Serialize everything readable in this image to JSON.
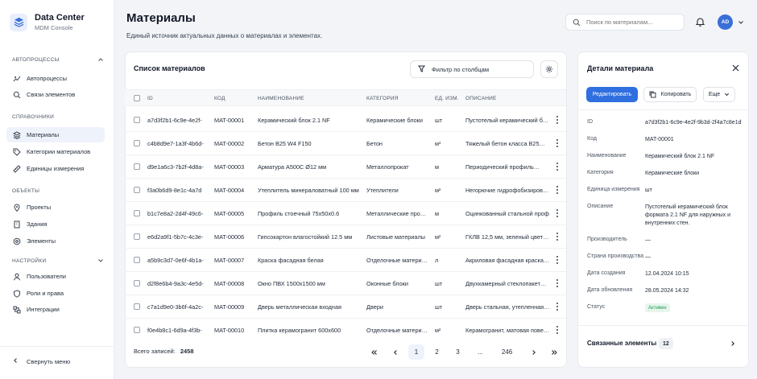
{
  "brand": {
    "title": "Data Center",
    "subtitle": "MDM Console"
  },
  "sidebar": {
    "sections": [
      {
        "label": "АВТОПРОЦЕССЫ"
      },
      {
        "label": "СПРАВОЧНИКИ"
      },
      {
        "label": "ОБЪЕКТЫ"
      },
      {
        "label": "НАСТРОЙКИ"
      }
    ],
    "items": [
      {
        "label": "Автопроцессы",
        "icon": "autoprocess-icon"
      },
      {
        "label": "Связи элементов",
        "icon": "link-search-icon"
      },
      {
        "label": "Материалы",
        "icon": "layers-icon",
        "active": true
      },
      {
        "label": "Категории материалов",
        "icon": "tag-icon"
      },
      {
        "label": "Единицы измерения",
        "icon": "ruler-icon"
      },
      {
        "label": "Проекты",
        "icon": "pin-icon"
      },
      {
        "label": "Здания",
        "icon": "building-icon"
      },
      {
        "label": "Элементы",
        "icon": "element-icon"
      },
      {
        "label": "Пользователи",
        "icon": "user-icon"
      },
      {
        "label": "Роли и права",
        "icon": "shield-icon"
      },
      {
        "label": "Интеграции",
        "icon": "integration-icon"
      }
    ],
    "collapse_label": "Свернуть меню"
  },
  "header": {
    "title": "Материалы",
    "subtitle": "Единый источник актуальных данных о материалах и элементах.",
    "search_placeholder": "Поиск по материалам...",
    "avatar": "AD"
  },
  "list": {
    "title": "Список материалов",
    "filter_label": "Фильтр по столбцам",
    "columns": [
      "ID",
      "КОД",
      "НАИМЕНОВАНИЕ",
      "КАТЕГОРИЯ",
      "ЕД. ИЗМ.",
      "ОПИСАНИЕ"
    ],
    "rows": [
      {
        "id": "a7d3f2b1-6c9e-4e2f-",
        "code": "MAT-00001",
        "name": "Керамический блок 2.1 NF",
        "category": "Керамические блоки",
        "unit": "шт",
        "desc": "Пустотелый керамический блок"
      },
      {
        "id": "c4b8d9e7-1a3f-4b6d-",
        "code": "MAT-00002",
        "name": "Бетон B25 W4 F150",
        "category": "Бетон",
        "unit": "м³",
        "desc": "Тяжелый бетон класса B25…"
      },
      {
        "id": "d9e1a6c3-7b2f-4d8a-",
        "code": "MAT-00003",
        "name": "Арматура A500C Ø12 мм",
        "category": "Металлопрокат",
        "unit": "м",
        "desc": "Периодический профиль…"
      },
      {
        "id": "f3a0b6d9-8e1c-4a7d",
        "code": "MAT-00004",
        "name": "Утеплитель минераловатный 100 мм",
        "category": "Утеплители",
        "unit": "м²",
        "desc": "Негорючие гидрофобизирова…"
      },
      {
        "id": "b1c7e8a2-2d4f-49c6-",
        "code": "MAT-00005",
        "name": "Профиль стоечный 75x50x0.6",
        "category": "Металлические профили",
        "unit": "м",
        "desc": "Оцинкованный стальной проф"
      },
      {
        "id": "e6d2a9f1-5b7c-4c3e-",
        "code": "MAT-00006",
        "name": "Гипсокартон влагостойкий 12.5 мм",
        "category": "Листовые материалы",
        "unit": "м²",
        "desc": "ГКЛВ 12,5 мм, зеленый цвет…"
      },
      {
        "id": "a5b9c3d7-0e6f-4b1a-",
        "code": "MAT-00007",
        "name": "Краска фасадная белая",
        "category": "Отделочные материалы",
        "unit": "л",
        "desc": "Акриловая фасадная краска…"
      },
      {
        "id": "d2f8e6b4-9a3c-4e5d-",
        "code": "MAT-00008",
        "name": "Окно ПВХ 1500x1500 мм",
        "category": "Оконные блоки",
        "unit": "шт",
        "desc": "Двухкамерный стеклопакет…"
      },
      {
        "id": "c7a1d9e0-3b6f-4a2c-",
        "code": "MAT-00009",
        "name": "Дверь металлическая входная",
        "category": "Двери",
        "unit": "шт",
        "desc": "Дверь стальная, утепленная…"
      },
      {
        "id": "f0e4b8c1-6d9a-4f3b-",
        "code": "MAT-00010",
        "name": "Плитка керамогранит 600x600",
        "category": "Отделочные материалы",
        "unit": "м²",
        "desc": "Керамогранит, матовая повер…"
      }
    ],
    "total_label": "Всего записей:",
    "total_value": "2458",
    "pagination": {
      "pages": [
        "1",
        "2",
        "3",
        "...",
        "246"
      ],
      "current": "1"
    }
  },
  "details": {
    "title": "Детали материала",
    "edit_label": "Редактировать",
    "copy_label": "Копировать",
    "more_label": "Еще",
    "fields": [
      {
        "label": "ID",
        "value": "a7d3f2b1-6c9e-4e2f-9b3d-2f4a7c8e1d9b"
      },
      {
        "label": "Код",
        "value": "MAT-00001"
      },
      {
        "label": "Наименование",
        "value": "Керамический блок 2.1 NF"
      },
      {
        "label": "Категория",
        "value": "Керамические блоки"
      },
      {
        "label": "Единица измерения",
        "value": "шт"
      },
      {
        "label": "Описание",
        "value": "Пустотелый керамический блок формата 2.1 NF для наружных и внутренних стен."
      },
      {
        "label": "Производитель",
        "value": "—"
      },
      {
        "label": "Страна производства",
        "value": "—"
      },
      {
        "label": "Дата создания",
        "value": "12.04.2024 10:15"
      },
      {
        "label": "Дата обновления",
        "value": "28.05.2024 14:32"
      },
      {
        "label": "Статус",
        "value": "Активен"
      }
    ],
    "related_label": "Связанные элементы",
    "related_count": "12"
  },
  "colors": {
    "accent": "#2f6fe0",
    "status_active": "#1f9d55",
    "background": "#f3f4f7"
  }
}
